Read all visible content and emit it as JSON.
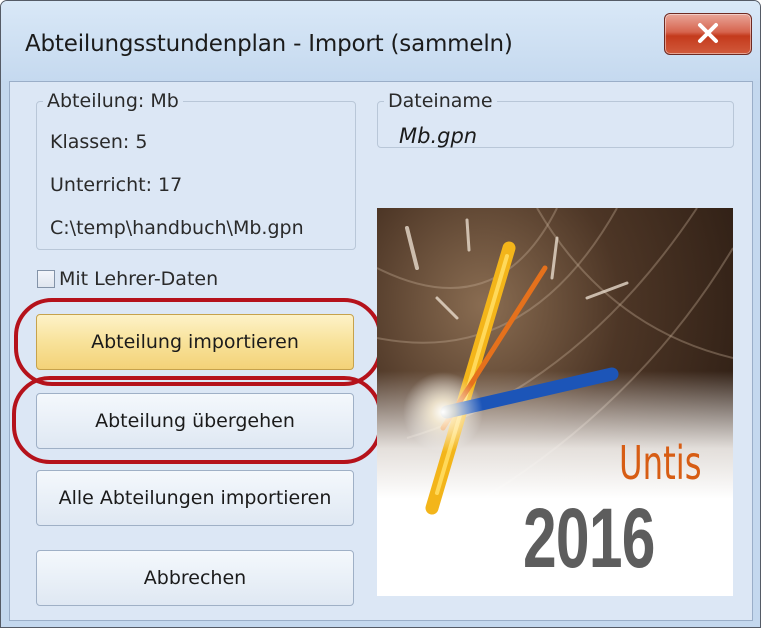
{
  "window": {
    "title": "Abteilungsstundenplan - Import (sammeln)",
    "close_label": "X"
  },
  "info_group": {
    "legend": "Abteilung: Mb",
    "classes": "Klassen: 5",
    "lessons": "Unterricht: 17",
    "path": "C:\\temp\\handbuch\\Mb.gpn"
  },
  "file_group": {
    "legend": "Dateiname",
    "value": "Mb.gpn"
  },
  "checkbox": {
    "label": "Mit Lehrer-Daten",
    "checked": false
  },
  "buttons": {
    "import_department": "Abteilung importieren",
    "skip_department": "Abteilung übergehen",
    "import_all": "Alle Abteilungen importieren",
    "cancel": "Abbrechen"
  },
  "logo": {
    "product": "Untis",
    "year": "2016"
  },
  "colors": {
    "highlight_ring": "#b5121b",
    "active_button": "#f8e29a",
    "brand_orange": "#d75d14"
  },
  "icons": {
    "close": "close-x-icon",
    "checkbox": "checkbox-icon"
  }
}
